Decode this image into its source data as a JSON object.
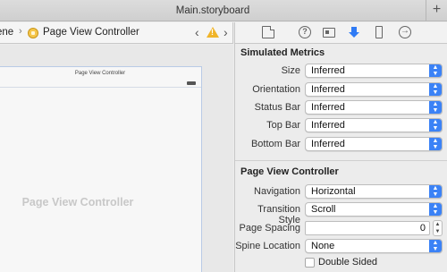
{
  "window": {
    "title": "Main.storyboard",
    "add_tab_label": "+"
  },
  "jumpbar": {
    "crumb_scene": "ene",
    "separator": "›",
    "crumb_controller": "Page View Controller",
    "back_glyph": "‹",
    "forward_glyph": "›"
  },
  "canvas": {
    "device_title": "Page View Controller",
    "center_label": "Page View Controller"
  },
  "inspector": {
    "tabs": [
      "file-inspector-icon",
      "quick-help-icon",
      "identity-inspector-icon",
      "attributes-inspector-icon",
      "size-inspector-icon",
      "connections-inspector-icon"
    ],
    "help_glyph": "?",
    "conn_glyph": "→",
    "accent_color": "#2f7bf5",
    "simulated_metrics": {
      "title": "Simulated Metrics",
      "rows": [
        {
          "label": "Size",
          "value": "Inferred"
        },
        {
          "label": "Orientation",
          "value": "Inferred"
        },
        {
          "label": "Status Bar",
          "value": "Inferred"
        },
        {
          "label": "Top Bar",
          "value": "Inferred"
        },
        {
          "label": "Bottom Bar",
          "value": "Inferred"
        }
      ]
    },
    "page_view_controller": {
      "title": "Page View Controller",
      "navigation": {
        "label": "Navigation",
        "value": "Horizontal"
      },
      "transition_style": {
        "label": "Transition Style",
        "value": "Scroll"
      },
      "page_spacing": {
        "label": "Page Spacing",
        "value": "0"
      },
      "spine_location": {
        "label": "Spine Location",
        "value": "None"
      },
      "double_sided": {
        "label": "Double Sided",
        "checked": false
      }
    }
  }
}
